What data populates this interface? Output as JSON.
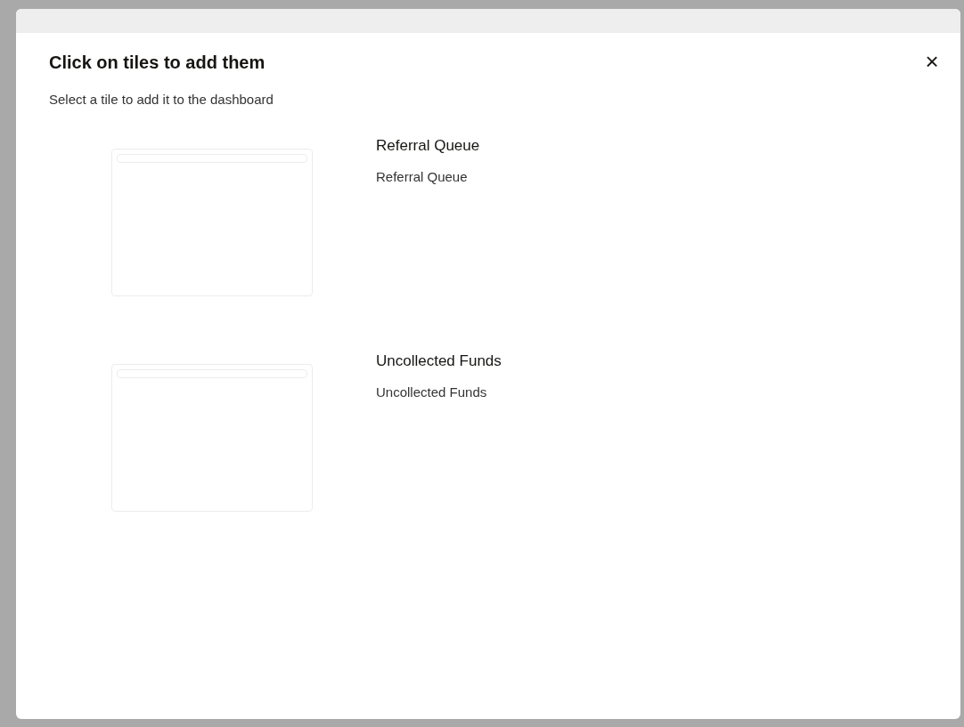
{
  "dialog": {
    "title": "Click on tiles to add them",
    "subtitle": "Select a tile to add it to the dashboard",
    "close": "×"
  },
  "tiles": [
    {
      "title": "Referral Queue",
      "description": "Referral Queue"
    },
    {
      "title": "Uncollected Funds",
      "description": "Uncollected Funds"
    }
  ]
}
